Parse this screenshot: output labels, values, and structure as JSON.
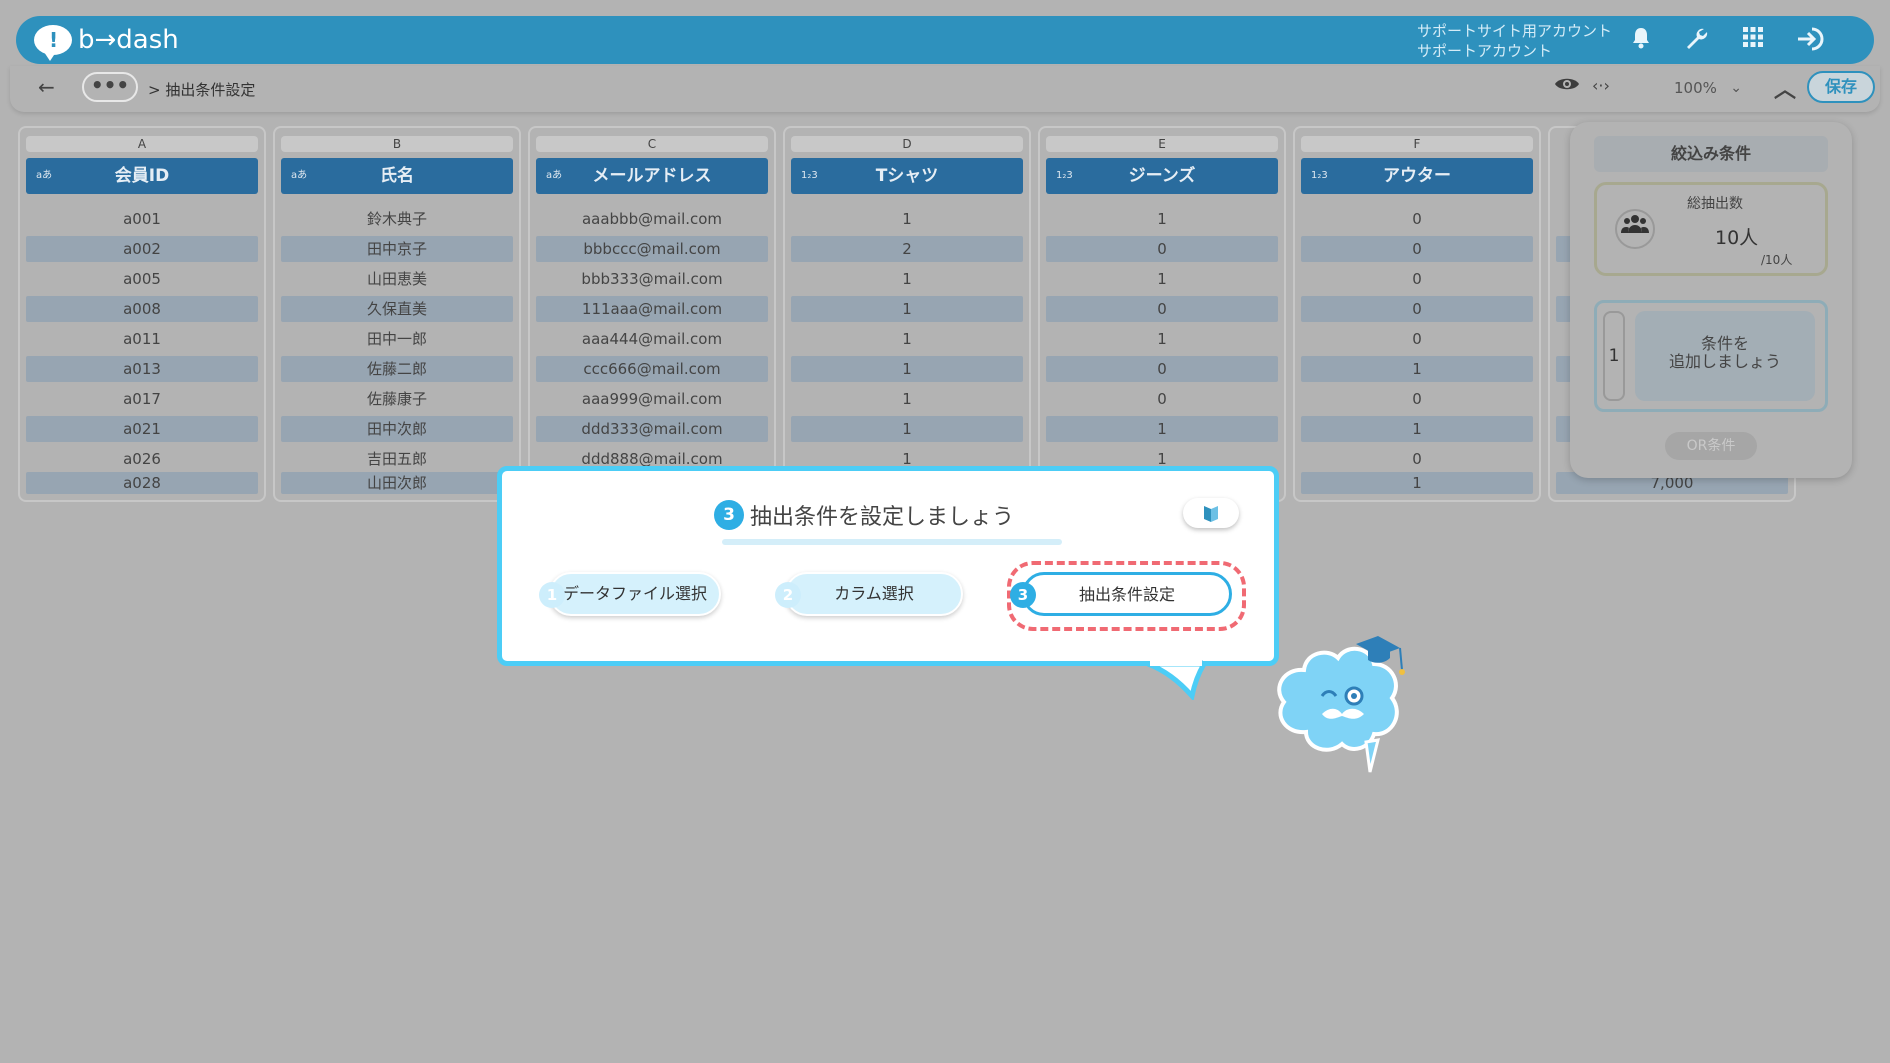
{
  "header": {
    "logo_text": "b→dash",
    "account_line1": "サポートサイト用アカウント",
    "account_line2": "サポートアカウント",
    "icons": [
      "bell-icon",
      "wrench-icon",
      "apps-grid-icon",
      "logout-icon"
    ]
  },
  "toolbar": {
    "back": "←",
    "more": "•••",
    "breadcrumb": "> 抽出条件設定",
    "zoom": "100%",
    "save": "保存"
  },
  "columns": [
    {
      "letter": "A",
      "type": "aあ",
      "name": "会員ID",
      "cells": [
        "a001",
        "a002",
        "a005",
        "a008",
        "a011",
        "a013",
        "a017",
        "a021",
        "a026",
        "a028"
      ]
    },
    {
      "letter": "B",
      "type": "aあ",
      "name": "氏名",
      "cells": [
        "鈴木典子",
        "田中京子",
        "山田恵美",
        "久保直美",
        "田中一郎",
        "佐藤二郎",
        "佐藤康子",
        "田中次郎",
        "吉田五郎",
        "山田次郎"
      ]
    },
    {
      "letter": "C",
      "type": "aあ",
      "name": "メールアドレス",
      "cells": [
        "aaabbb@mail.com",
        "bbbccc@mail.com",
        "bbb333@mail.com",
        "111aaa@mail.com",
        "aaa444@mail.com",
        "ccc666@mail.com",
        "aaa999@mail.com",
        "ddd333@mail.com",
        "ddd888@mail.com",
        ""
      ]
    },
    {
      "letter": "D",
      "type": "1₂3",
      "name": "Tシャツ",
      "cells": [
        "1",
        "2",
        "1",
        "1",
        "1",
        "1",
        "1",
        "1",
        "1",
        ""
      ]
    },
    {
      "letter": "E",
      "type": "1₂3",
      "name": "ジーンズ",
      "cells": [
        "1",
        "0",
        "1",
        "0",
        "1",
        "0",
        "0",
        "1",
        "1",
        ""
      ]
    },
    {
      "letter": "F",
      "type": "1₂3",
      "name": "アウター",
      "cells": [
        "0",
        "0",
        "0",
        "0",
        "0",
        "1",
        "0",
        "1",
        "0",
        "1"
      ]
    },
    {
      "letter": "",
      "type": "1",
      "name": "",
      "cells": [
        "",
        "",
        "",
        "",
        "",
        "",
        "",
        "",
        "",
        "7,000"
      ]
    }
  ],
  "panel": {
    "title": "絞込み条件",
    "count_label": "総抽出数",
    "count": "10人",
    "total": "/10人",
    "cond_index": "1",
    "cond_add_line1": "条件を",
    "cond_add_line2": "追加しましょう",
    "or_button": "OR条件"
  },
  "dialog": {
    "step_num": "3",
    "title": "抽出条件を設定しましょう",
    "steps": [
      {
        "num": "1",
        "label": "データファイル選択"
      },
      {
        "num": "2",
        "label": "カラム選択"
      },
      {
        "num": "3",
        "label": "抽出条件設定"
      }
    ]
  },
  "colors": {
    "header": "#2e91bd",
    "column_header": "#2a6c9e",
    "dialog_border": "#4ccdf6",
    "highlight_dash": "#f06a73"
  }
}
